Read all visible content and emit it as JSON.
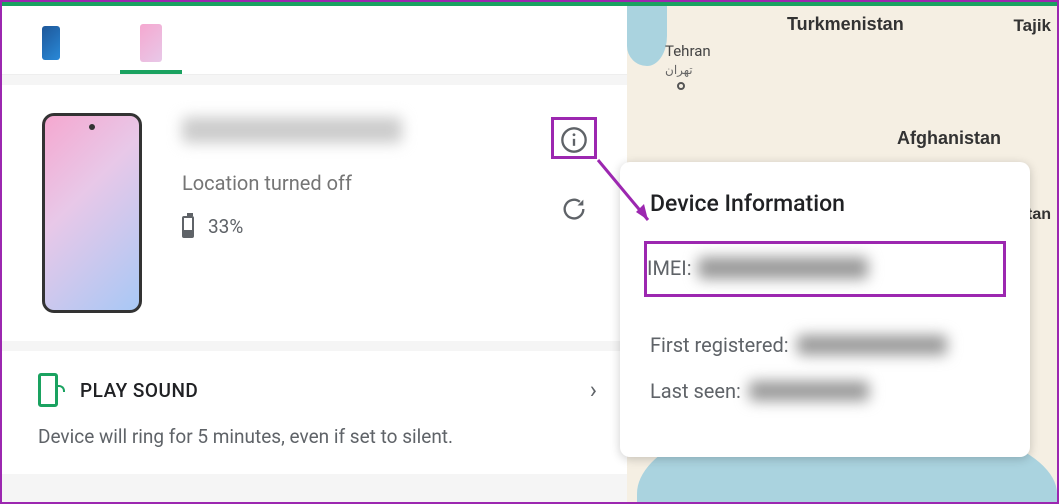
{
  "colors": {
    "accent": "#1aa260",
    "annotation": "#9c27b0"
  },
  "devices": {
    "tab1": {
      "name": "device-blue"
    },
    "tab2": {
      "name": "device-pink",
      "active": true
    }
  },
  "selected_device": {
    "name": "[blurred]",
    "location_status": "Location turned off",
    "battery_percent": "33%"
  },
  "actions": {
    "play_sound": {
      "title": "PLAY SOUND",
      "description": "Device will ring for 5 minutes, even if set to silent."
    }
  },
  "device_info": {
    "title": "Device Information",
    "imei_label": "IMEI:",
    "imei_value": "[blurred]",
    "first_registered_label": "First registered:",
    "first_registered_value": "[blurred]",
    "last_seen_label": "Last seen:",
    "last_seen_value": "[blurred]"
  },
  "map": {
    "labels": {
      "turkmenistan": "Turkmenistan",
      "tajikistan": "Tajik",
      "afghanistan": "Afghanistan",
      "istan": "istan",
      "tehran": "Tehran",
      "tehran_native": "تهران"
    }
  }
}
